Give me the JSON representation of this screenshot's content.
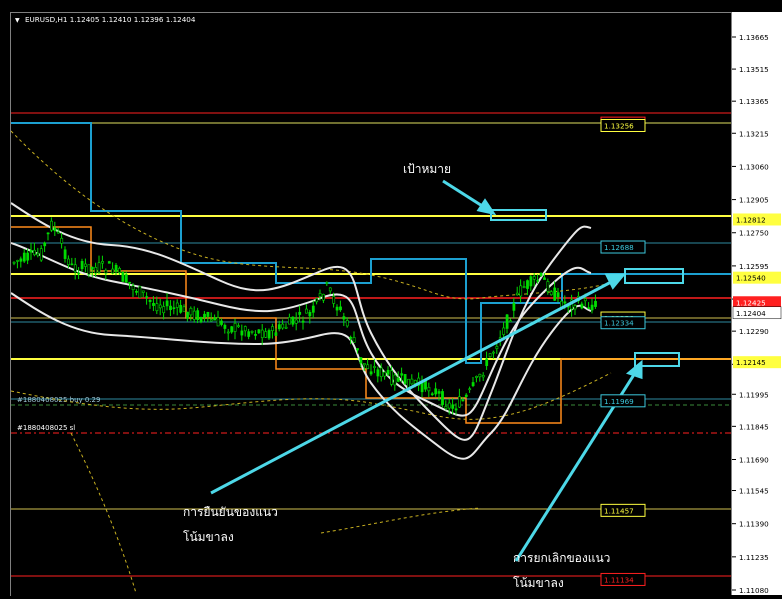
{
  "header": {
    "symbol_info": "EURUSD,H1  1.12405 1.12410 1.12396 1.12404"
  },
  "price_axis": {
    "ticks": [
      "1.13665",
      "1.13515",
      "1.13365",
      "1.13215",
      "1.13060",
      "1.12905",
      "1.12750",
      "1.12595",
      "1.12440",
      "1.12290",
      "1.12135",
      "1.11995",
      "1.11845",
      "1.11690",
      "1.11545",
      "1.11390",
      "1.11235",
      "1.11080"
    ],
    "current_price": "1.12404"
  },
  "levels": [
    {
      "price": "1.13267",
      "color": "#ff2020"
    },
    {
      "price": "1.13256",
      "color": "#ffff40"
    },
    {
      "price": "1.12812",
      "color": "#ffff40"
    },
    {
      "price": "1.12688",
      "color": "#3cc8dc"
    },
    {
      "price": "1.12540",
      "color": "#ffff40"
    },
    {
      "price": "1.12425",
      "color": "#ff2020"
    },
    {
      "price": "1.12356",
      "color": "#ffff40"
    },
    {
      "price": "1.12334",
      "color": "#3cc8dc"
    },
    {
      "price": "1.12145",
      "color": "#ffff40"
    },
    {
      "price": "1.11969",
      "color": "#3cc8dc"
    },
    {
      "price": "1.11457",
      "color": "#ffff40"
    },
    {
      "price": "1.11134",
      "color": "#ff2020"
    }
  ],
  "orders": {
    "buy_label": "#1880408025 buy 0.29",
    "sl_label": "#1880408025 sl"
  },
  "annotations": {
    "target": "เป้าหมาย",
    "confirm_line1": "การยืนยันของแนว",
    "confirm_line2": "โน้มขาลง",
    "cancel_line1": "การยกเลิกของแนว",
    "cancel_line2": "โน้มขาลง"
  },
  "colors": {
    "background": "#000000",
    "bull_candle": "#00dd00",
    "axis_bg": "#ffffff",
    "arrow": "#4dd8e8"
  }
}
